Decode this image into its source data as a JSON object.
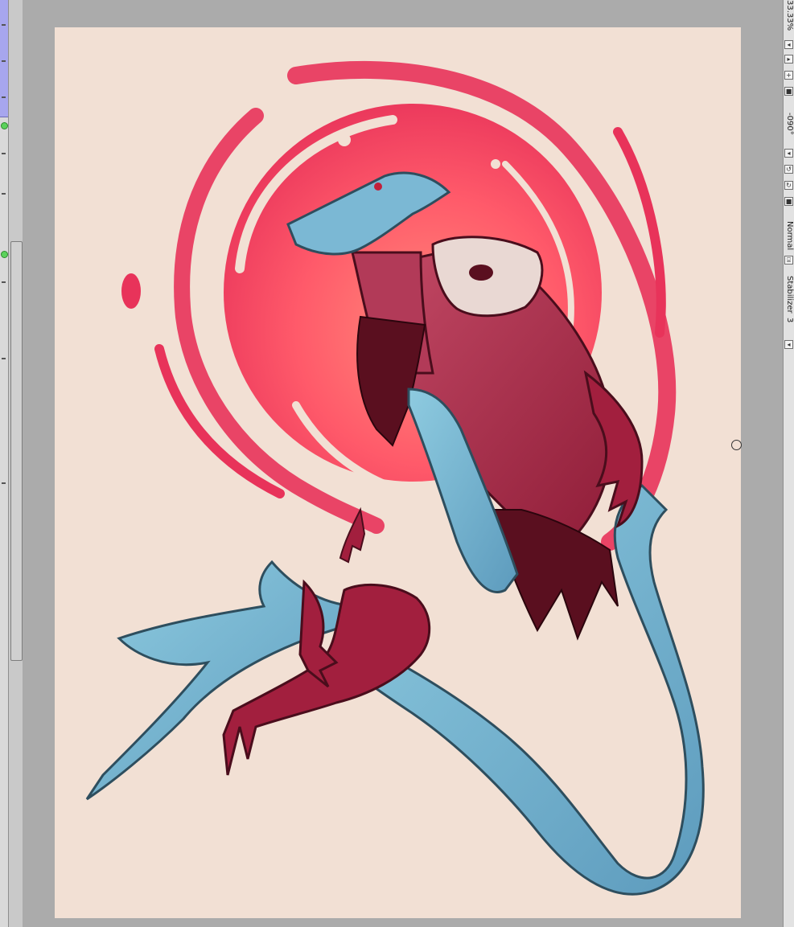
{
  "zoom_level": "33.33%",
  "rotation": "-090°",
  "blend_mode": "Normal",
  "stabilizer": {
    "label": "Stabilizer",
    "value": "3"
  },
  "colors": {
    "background_gray": "#ababab",
    "paper": "#f2e0d4",
    "swirl_red": "#e8335a",
    "moon_pink": "#ff6f6a",
    "dragon_blue": "#7ab8d2",
    "dragon_red": "#a21f3e",
    "cloth_dark": "#5a0f1f"
  },
  "icons": [
    "zoom-out-icon",
    "zoom-in-icon",
    "fit-icon",
    "rotate-left-icon",
    "rotate-right-icon",
    "reset-icon",
    "brush-cursor-icon"
  ]
}
